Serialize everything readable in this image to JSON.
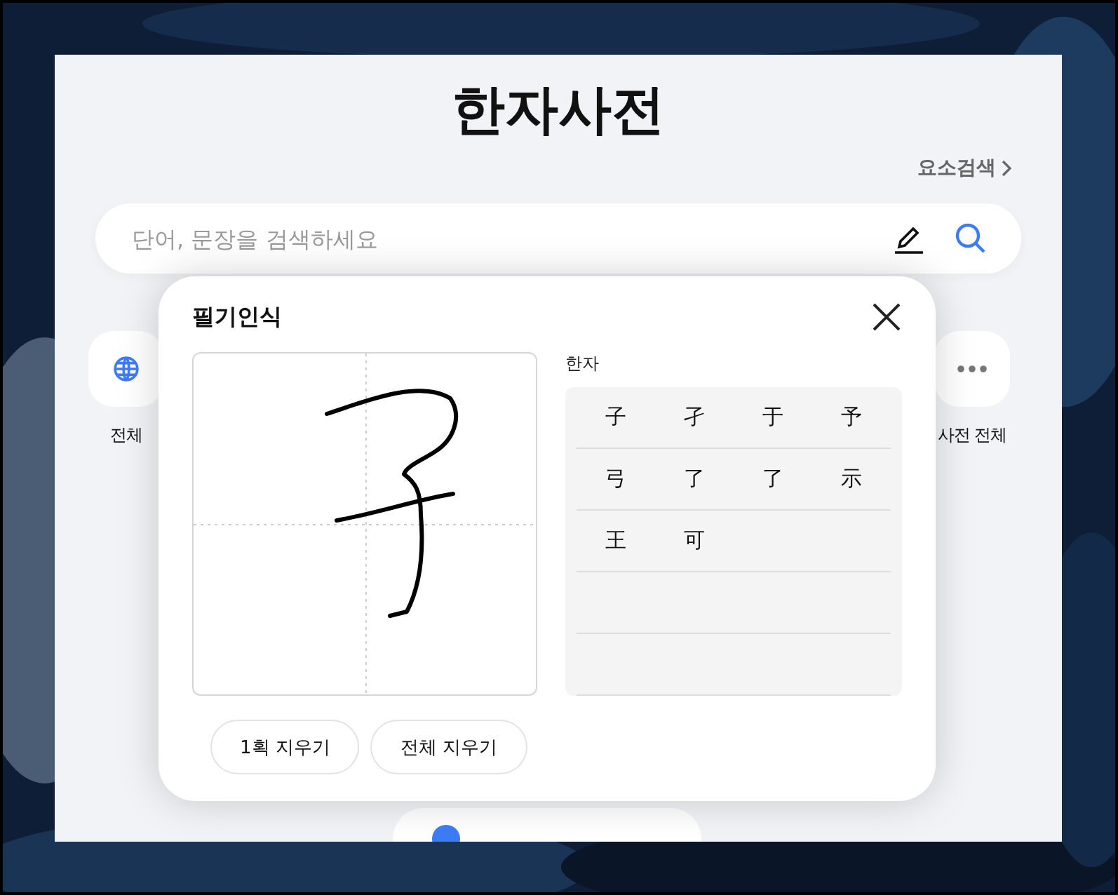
{
  "title": "한자사전",
  "element_search": {
    "label": "요소검색"
  },
  "search": {
    "placeholder": "단어, 문장을 검색하세요"
  },
  "categories": [
    {
      "label": "전체",
      "kind": "globe"
    },
    {
      "label": "사전 전체",
      "kind": "more"
    }
  ],
  "handwriting_panel": {
    "title": "필기인식",
    "result_label": "한자",
    "candidates": [
      "子",
      "孑",
      "于",
      "予",
      "弓",
      "了",
      "了",
      "示",
      "王",
      "可"
    ],
    "buttons": [
      "1획 지우기",
      "전체 지우기"
    ]
  }
}
